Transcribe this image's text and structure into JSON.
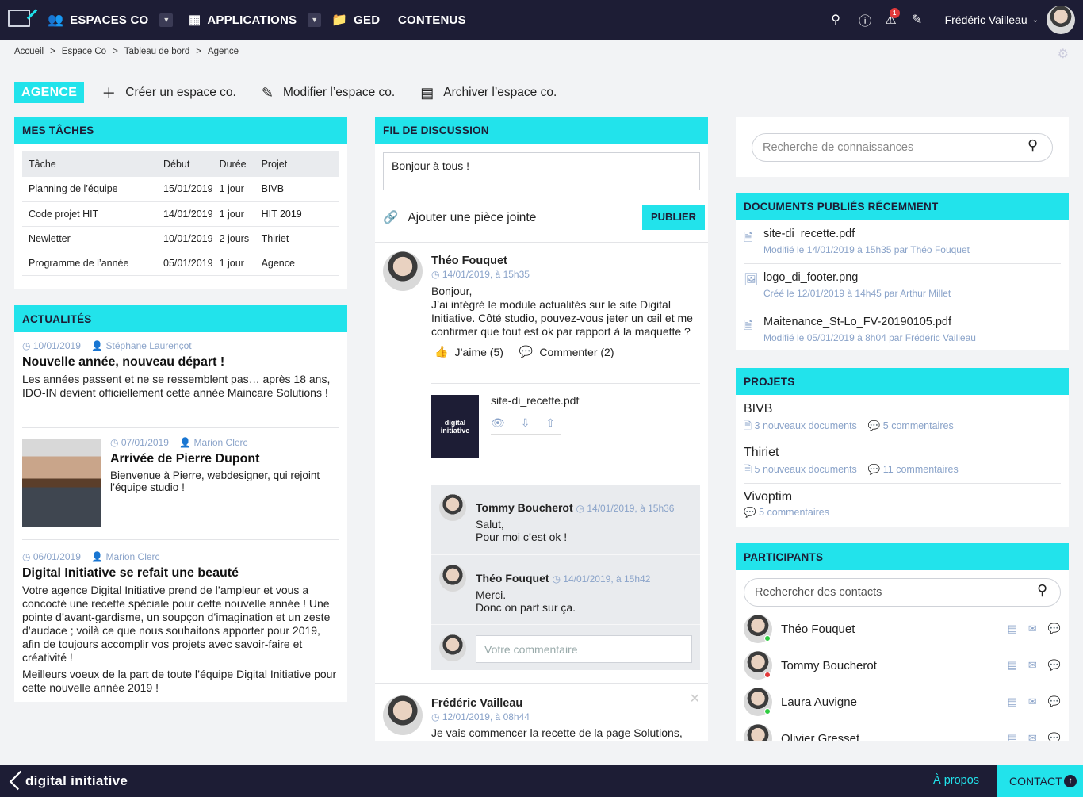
{
  "topbar": {
    "nav": [
      {
        "icon": "users-icon",
        "label": "ESPACES CO",
        "dropdown": true
      },
      {
        "icon": "grid-icon",
        "label": "APPLICATIONS",
        "dropdown": true
      },
      {
        "icon": "folder-icon",
        "label": "GED",
        "dropdown": false
      },
      {
        "label": "CONTENUS"
      }
    ],
    "alert_count": "1",
    "user_name": "Frédéric Vailleau"
  },
  "breadcrumb": [
    "Accueil",
    ">",
    "Espace Co",
    ">",
    "Tableau de bord",
    ">",
    "Agence"
  ],
  "actions": {
    "tag": "AGENCE",
    "create": "Créer un espace co.",
    "edit": "Modifier l’espace co.",
    "archive": "Archiver l’espace co."
  },
  "tasks": {
    "title": "MES TÂCHES",
    "headers": [
      "Tâche",
      "Début",
      "Durée",
      "Projet"
    ],
    "rows": [
      [
        "Planning de l’équipe",
        "15/01/2019",
        "1 jour",
        "BIVB"
      ],
      [
        "Code projet HIT",
        "14/01/2019",
        "1 jour",
        "HIT 2019"
      ],
      [
        "Newletter",
        "10/01/2019",
        "2 jours",
        "Thiriet"
      ],
      [
        "Programme de l’année",
        "05/01/2019",
        "1 jour",
        "Agence"
      ]
    ]
  },
  "news": {
    "title": "ACTUALITÉS",
    "items": [
      {
        "date": "10/01/2019",
        "author": "Stéphane Laurençot",
        "title": "Nouvelle année, nouveau départ !",
        "text": "Les années passent et ne se ressemblent pas… après 18 ans, IDO-IN devient officiellement cette année Maincare Solutions !"
      },
      {
        "date": "07/01/2019",
        "author": "Marion Clerc",
        "title": "Arrivée de Pierre Dupont",
        "text": "Bienvenue à Pierre, webdesigner, qui rejoint l’équipe studio !"
      },
      {
        "date": "06/01/2019",
        "author": "Marion Clerc",
        "title": "Digital Initiative se refait une beauté",
        "text": "Votre agence Digital Initiative prend de l’ampleur et vous a concocté une recette spéciale pour cette nouvelle année ! Une pointe d’avant-gardisme, un soupçon d’imagination et un zeste d’audace ; voilà ce que nous souhaitons apporter pour 2019, afin de toujours accomplir vos projets avec savoir-faire et créativité !",
        "text2": "Meilleurs voeux de la part de toute l’équipe Digital Initiative pour cette nouvelle année 2019 !"
      }
    ]
  },
  "thread": {
    "title": "FIL DE DISCUSSION",
    "input_value": "Bonjour à tous !",
    "attach": "Ajouter une pièce jointe",
    "publish": "PUBLIER",
    "post1": {
      "author": "Théo Fouquet",
      "date": "14/01/2019, à 15h35",
      "text1": "Bonjour,",
      "text2": "J’ai intégré le module actualités sur le site Digital Initiative. Côté studio, pouvez-vous jeter un œil et me confirmer que tout est ok par rapport à la maquette ?",
      "like": "J’aime (5)",
      "comment": "Commenter (2)",
      "file": "site-di_recette.pdf",
      "thumb": "digital initiative"
    },
    "replies": [
      {
        "author": "Tommy Boucherot",
        "date": "14/01/2019, à 15h36",
        "l1": "Salut,",
        "l2": "Pour moi c’est ok !"
      },
      {
        "author": "Théo Fouquet",
        "date": "14/01/2019, à 15h42",
        "l1": "Merci.",
        "l2": "Donc on part sur ça."
      }
    ],
    "comment_placeholder": "Votre commentaire",
    "post2": {
      "author": "Frédéric Vailleau",
      "date": "12/01/2019, à 08h44",
      "text": "Je vais commencer la recette de la page Solutions,"
    }
  },
  "search": {
    "placeholder": "Recherche de connaissances"
  },
  "docs": {
    "title": "DOCUMENTS PUBLIÉS RÉCEMMENT",
    "items": [
      {
        "name": "site-di_recette.pdf",
        "sub": "Modifié le 14/01/2019 à 15h35 par Théo Fouquet"
      },
      {
        "name": "logo_di_footer.png",
        "sub": "Créé le 12/01/2019 à 14h45 par Arthur Millet"
      },
      {
        "name": "Maitenance_St-Lo_FV-20190105.pdf",
        "sub": "Modifié le 05/01/2019 à 8h04 par Frédéric Vailleau"
      }
    ]
  },
  "projects": {
    "title": "PROJETS",
    "items": [
      {
        "name": "BIVB",
        "docs": "3 nouveaux documents",
        "comments": "5 commentaires"
      },
      {
        "name": "Thiriet",
        "docs": "5 nouveaux documents",
        "comments": "11 commentaires"
      },
      {
        "name": "Vivoptim",
        "comments": "5 commentaires"
      }
    ]
  },
  "participants": {
    "title": "PARTICIPANTS",
    "placeholder": "Rechercher des contacts",
    "items": [
      {
        "name": "Théo Fouquet",
        "status": "#2ecc40"
      },
      {
        "name": "Tommy Boucherot",
        "status": "#e2393a"
      },
      {
        "name": "Laura Auvigne",
        "status": "#2ecc40"
      },
      {
        "name": "Olivier Gresset",
        "status": "#2ecc40"
      }
    ]
  },
  "footer": {
    "brand": "digital initiative",
    "about": "À propos",
    "contact": "CONTACT"
  }
}
